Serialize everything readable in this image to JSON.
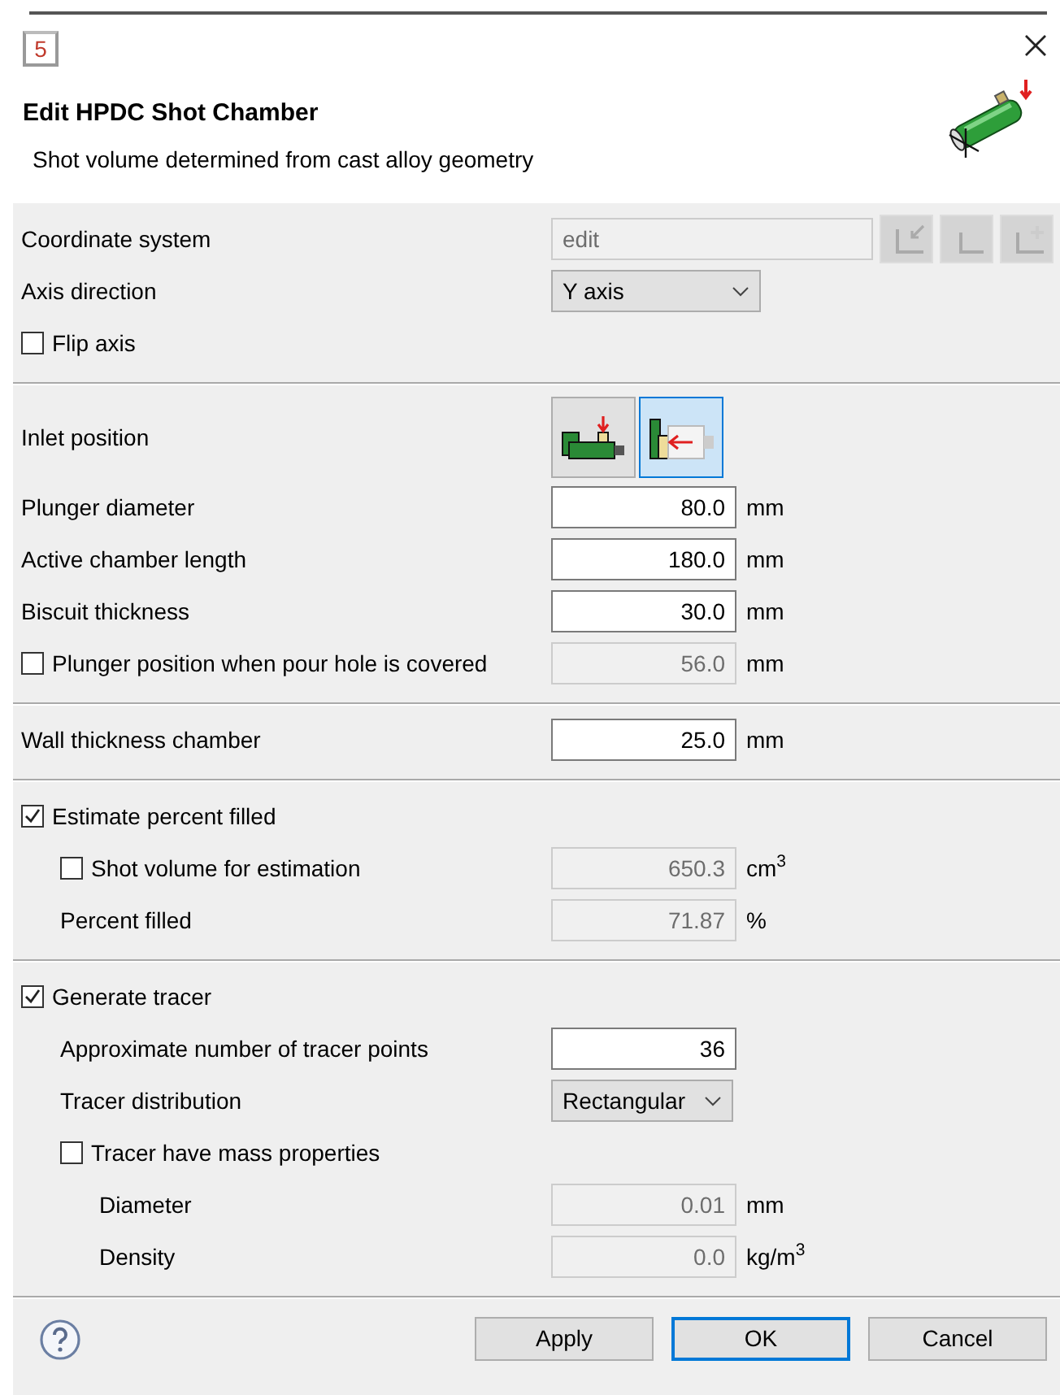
{
  "window": {
    "app_icon_text": "5"
  },
  "header": {
    "title": "Edit HPDC Shot Chamber",
    "subtitle": "Shot volume determined from cast alloy geometry"
  },
  "sections": [
    {
      "rows": [
        {
          "kind": "coordinate",
          "label": "Coordinate system",
          "value": "edit",
          "disabled": true,
          "tool_buttons": [
            {
              "disabled": true
            },
            {
              "disabled": true
            },
            {
              "disabled": true
            }
          ]
        },
        {
          "kind": "select",
          "label": "Axis direction",
          "value": "Y axis"
        },
        {
          "kind": "checkbox",
          "label": "Flip axis",
          "checked": false
        }
      ]
    },
    {
      "rows": [
        {
          "kind": "inlet",
          "label": "Inlet position",
          "options": [
            {
              "selected": false
            },
            {
              "selected": true
            }
          ]
        },
        {
          "kind": "field",
          "label": "Plunger diameter",
          "value": "80.0",
          "unit": "mm",
          "disabled": false
        },
        {
          "kind": "field",
          "label": "Active chamber length",
          "value": "180.0",
          "unit": "mm",
          "disabled": false
        },
        {
          "kind": "field",
          "label": "Biscuit thickness",
          "value": "30.0",
          "unit": "mm",
          "disabled": false
        },
        {
          "kind": "checkbox-field",
          "label": "Plunger position when pour hole is covered",
          "checked": false,
          "value": "56.0",
          "unit": "mm",
          "disabled": true
        }
      ]
    },
    {
      "rows": [
        {
          "kind": "field",
          "label": "Wall thickness chamber",
          "value": "25.0",
          "unit": "mm",
          "disabled": false
        }
      ]
    },
    {
      "rows": [
        {
          "kind": "checkbox",
          "label": "Estimate percent filled",
          "checked": true,
          "children": [
            {
              "kind": "checkbox-field",
              "label": "Shot volume for estimation",
              "checked": false,
              "value": "650.3",
              "unit": "cm$^{3}$",
              "disabled": true
            },
            {
              "kind": "field",
              "label": "Percent filled",
              "value": "71.87",
              "unit": "%",
              "disabled": true
            }
          ]
        }
      ]
    },
    {
      "rows": [
        {
          "kind": "checkbox",
          "label": "Generate tracer",
          "checked": true,
          "children": [
            {
              "kind": "field",
              "label": "Approximate number of tracer points",
              "value": "36",
              "disabled": false
            },
            {
              "kind": "select",
              "label": "Tracer distribution",
              "value": "Rectangular"
            },
            {
              "kind": "checkbox",
              "label": "Tracer have mass properties",
              "checked": false,
              "children": [
                {
                  "kind": "field",
                  "label": "Diameter",
                  "value": "0.01",
                  "unit": "mm",
                  "disabled": true
                },
                {
                  "kind": "field",
                  "label": "Density",
                  "value": "0.0",
                  "unit": "kg/m$^{3}$",
                  "disabled": true
                }
              ]
            }
          ]
        }
      ]
    }
  ],
  "footer": {
    "buttons": [
      {
        "label": "Apply",
        "default": false
      },
      {
        "label": "OK",
        "default": true
      },
      {
        "label": "Cancel",
        "default": false
      }
    ]
  }
}
